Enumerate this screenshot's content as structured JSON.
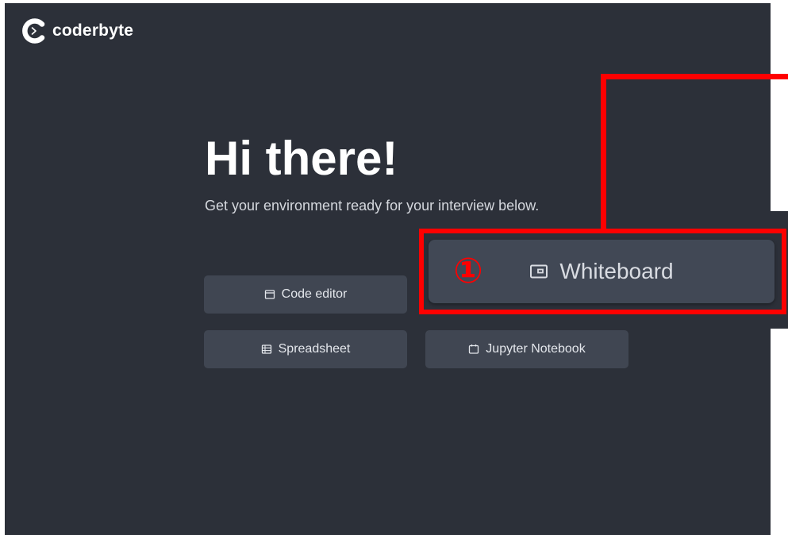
{
  "brand": {
    "name": "coderbyte",
    "logo_icon": "coderbyte-logo-icon"
  },
  "hero": {
    "title": "Hi there!",
    "subtitle": "Get your environment ready for your interview below."
  },
  "environments": {
    "code_editor": {
      "label": "Code editor",
      "icon": "window-icon"
    },
    "whiteboard": {
      "label": "Whiteboard",
      "icon": "whiteboard-icon"
    },
    "spreadsheet": {
      "label": "Spreadsheet",
      "icon": "table-icon"
    },
    "jupyter": {
      "label": "Jupyter Notebook",
      "icon": "notebook-icon"
    }
  },
  "annotation": {
    "step": "①",
    "color": "#ff0000"
  },
  "colors": {
    "background": "#2c3039",
    "button": "#404652",
    "text": "#ffffff"
  }
}
